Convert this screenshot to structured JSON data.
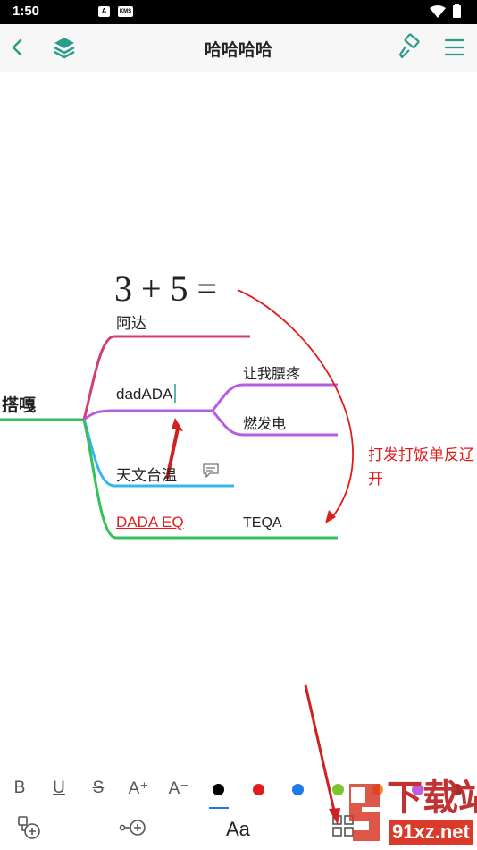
{
  "status": {
    "time": "1:50",
    "icon1": "A",
    "icon2": "KMS"
  },
  "header": {
    "title": "哈哈哈哈"
  },
  "mindmap": {
    "formula": "3 + 5 =",
    "root": "搭嘎",
    "branches": [
      {
        "label": "阿达",
        "color": "#d1406b"
      },
      {
        "label": "dadADA",
        "color": "#b65ee0"
      },
      {
        "label": "天文台温",
        "color": "#3ab4ee"
      },
      {
        "label": "DADA EQ",
        "color": "#32c15a"
      }
    ],
    "subnodes": [
      "让我腰疼",
      "燃发电"
    ],
    "extra_label": "TEQA",
    "annotation_line1": "打发打饭单反辽",
    "annotation_line2": "开"
  },
  "format_toolbar": {
    "bold": "B",
    "underline": "U",
    "strike": "S",
    "font_up": "A⁺",
    "font_down": "A⁻",
    "colors": [
      "#000000",
      "#e41b1b",
      "#1c7be8",
      "#7bc62c",
      "#f5901e",
      "#c15de0",
      "#a82a2a"
    ]
  },
  "bottom_toolbar": {
    "text_style": "Aa"
  },
  "watermark": {
    "brand": "下载站",
    "site": "91xz.net"
  }
}
